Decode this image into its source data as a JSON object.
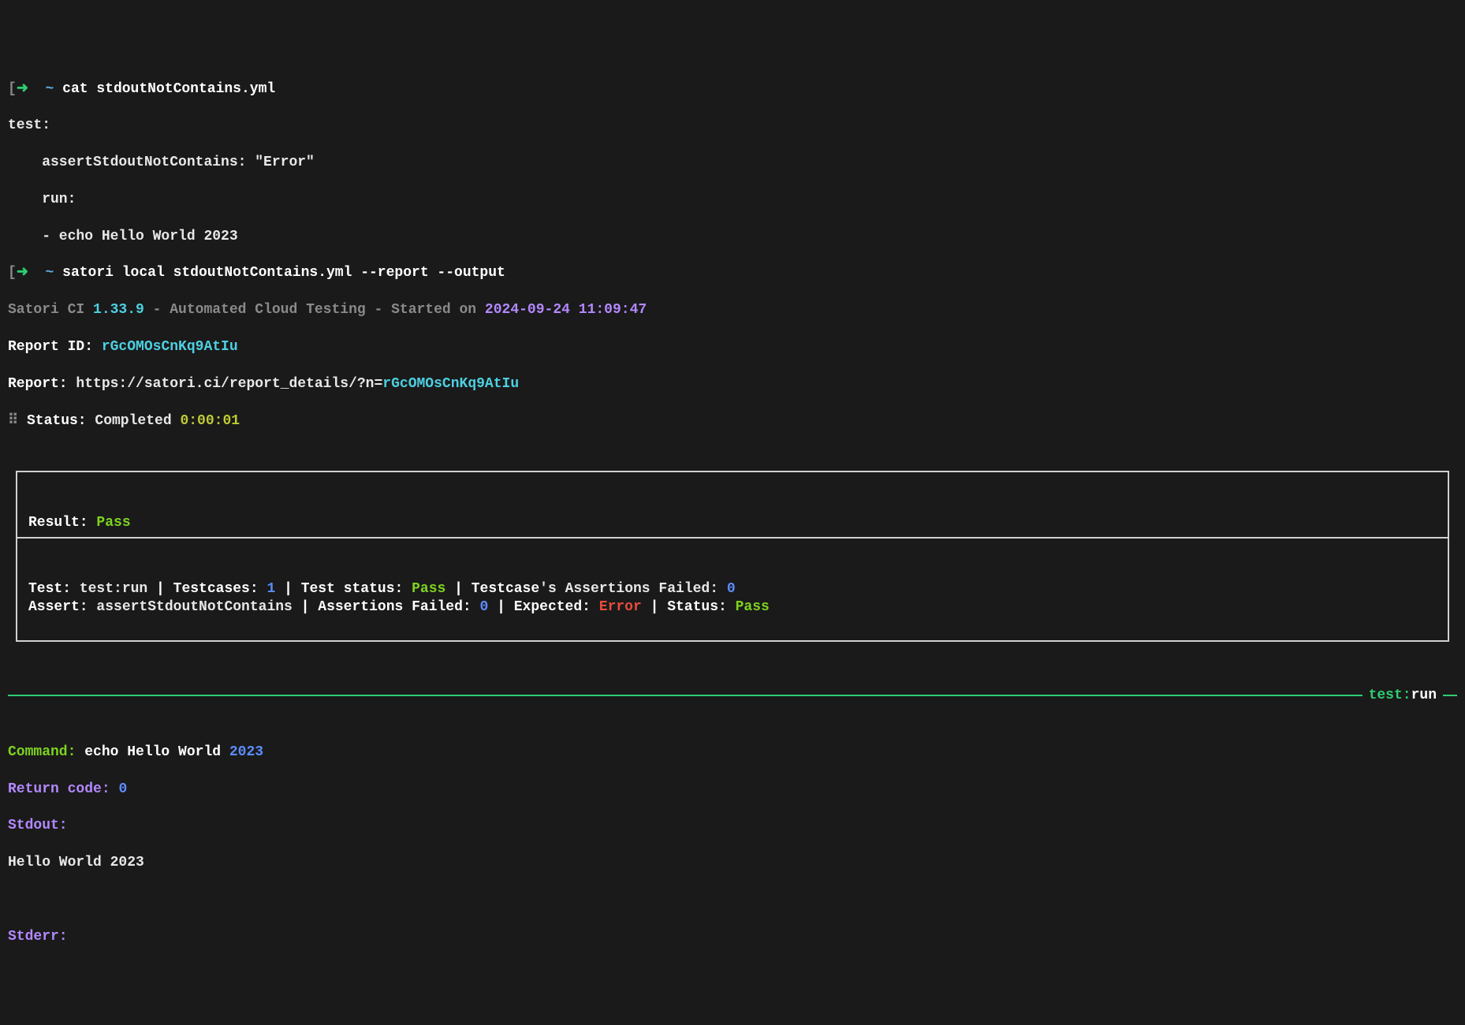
{
  "prompt": {
    "arrow": "➜",
    "tilde": "~"
  },
  "commands": {
    "cat": "cat stdoutNotContains.yml",
    "satori": "satori local stdoutNotContains.yml --report --output"
  },
  "yml": {
    "l1": "test:",
    "l2": "    assertStdoutNotContains: \"Error\"",
    "l3": "    run:",
    "l4": "    - echo Hello World 2023"
  },
  "banner": {
    "prefix": "Satori CI ",
    "version": "1.33.9",
    "mid": " - Automated Cloud Testing - Started on ",
    "ts_date": "2024-09-24",
    "ts_sep": " ",
    "ts_time": "11:09:47"
  },
  "report_id": {
    "label": "Report ID: ",
    "value": "rGcOMOsCnKq9AtIu"
  },
  "report_url": {
    "label": "Report: ",
    "url_base": "https://satori.ci/report_details/?n=",
    "url_id": "rGcOMOsCnKq9AtIu"
  },
  "status_line": {
    "spinner": "⠿",
    "label": " Status: ",
    "value": "Completed ",
    "time": "0:00:01"
  },
  "result_box": {
    "result_label": "Result: ",
    "result_value": "Pass",
    "test_label": "Test: ",
    "test_name": "test:run",
    "sep": " | ",
    "testcases_label": "Testcases: ",
    "testcases_value": "1",
    "teststatus_label": "Test status: ",
    "teststatus_value": "Pass",
    "tc_assert_fail_label_bold": "Testcase",
    "tc_assert_fail_label_rest": "'s Assertions Failed: ",
    "tc_assert_fail_value": "0",
    "assert_label": "Assert: ",
    "assert_name": "assertStdoutNotContains",
    "assertions_failed_label": "Assertions Failed: ",
    "assertions_failed_value": "0",
    "expected_label": "Expected: ",
    "expected_value": "Error",
    "status_label": "Status: ",
    "status_value": "Pass"
  },
  "section_label": {
    "prefix": "test:",
    "bold": "run"
  },
  "output": {
    "command_label": "Command: ",
    "command_value_a": "echo Hello World ",
    "command_value_b": "2023",
    "return_label": "Return code: ",
    "return_value": "0",
    "stdout_label": "Stdout:",
    "stdout_value": "Hello World 2023",
    "stderr_label": "Stderr:"
  }
}
